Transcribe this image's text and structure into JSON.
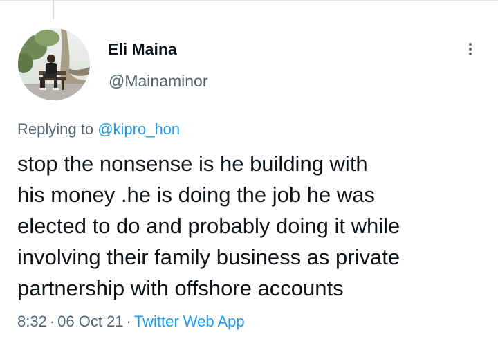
{
  "author": {
    "name": "Eli Maina",
    "handle": "@Mainaminor"
  },
  "reply": {
    "prefix": "Replying to ",
    "mention": "@kipro_hon"
  },
  "tweet_text_lines": [
    "stop the nonsense is he building with",
    "his money .he is doing the job he was",
    "elected to do and probably doing it while",
    "involving their family business as private",
    "partnership with offshore accounts"
  ],
  "meta": {
    "time": "8:32",
    "date": "06 Oct 21",
    "separator": "·",
    "source": "Twitter Web App"
  },
  "colors": {
    "text": "#0f1419",
    "secondary": "#536471",
    "link": "#1d9bf0"
  },
  "icons": {
    "more": "more-vertical-icon"
  }
}
